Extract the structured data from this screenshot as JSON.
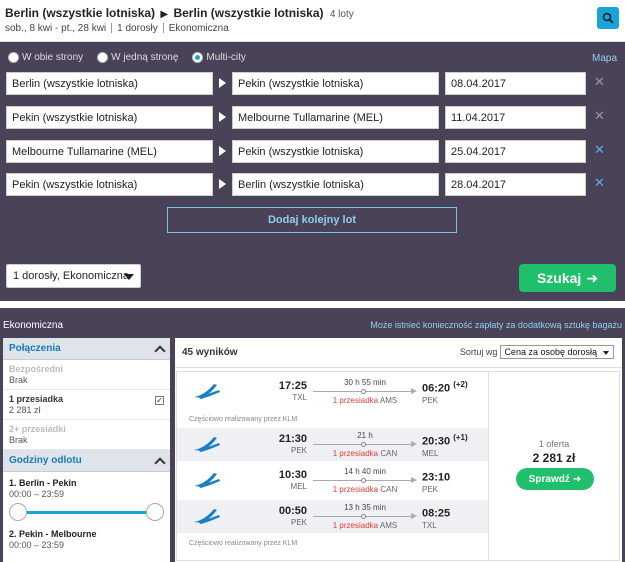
{
  "summary": {
    "origin": "Berlin (wszystkie lotniska)",
    "destination": "Berlin (wszystkie lotniska)",
    "legs_count": "4 loty",
    "dates": "sob., 8 kwi - pt., 28 kwi",
    "passengers": "1 dorosły",
    "cabin": "Ekonomiczna"
  },
  "search": {
    "trip_types": [
      {
        "label": "W obie strony",
        "selected": false
      },
      {
        "label": "W jedną stronę",
        "selected": false
      },
      {
        "label": "Multi-city",
        "selected": true
      }
    ],
    "map_link": "Mapa",
    "legs": [
      {
        "from": "Berlin (wszystkie lotniska)",
        "to": "Pekin (wszystkie lotniska)",
        "date": "08.04.2017",
        "remove_icon": "close-icon-grey"
      },
      {
        "from": "Pekin (wszystkie lotniska)",
        "to": "Melbourne Tullamarine (MEL)",
        "date": "11.04.2017",
        "remove_icon": "close-icon-grey"
      },
      {
        "from": "Melbourne Tullamarine (MEL)",
        "to": "Pekin (wszystkie lotniska)",
        "date": "25.04.2017",
        "remove_icon": "close-icon-blue"
      },
      {
        "from": "Pekin (wszystkie lotniska)",
        "to": "Berlin (wszystkie lotniska)",
        "date": "28.04.2017",
        "remove_icon": "close-icon-blue"
      }
    ],
    "add_flight": "Dodaj kolejny lot",
    "pax_selector": "1 dorosły, Ekonomiczna",
    "search_button": "Szukaj"
  },
  "results": {
    "cabin_label": "Ekonomiczna",
    "baggage_note": "Może istnieć konieczność zapłaty za dodatkową sztukę bagażu",
    "count": "45 wyników",
    "sort_label": "Sortuj wg",
    "sort_value": "Cena za osobę dorosłą",
    "filters": {
      "connections_title": "Połączenia",
      "connections": [
        {
          "label": "Bezpośredni",
          "value": "Brak",
          "dim": true,
          "checked": false
        },
        {
          "label": "1 przesiadka",
          "value": "2 281 zł",
          "dim": false,
          "checked": true
        },
        {
          "label": "2+ przesiadki",
          "value": "Brak",
          "dim": true,
          "checked": false
        }
      ],
      "times_title": "Godziny odlotu",
      "times": [
        {
          "label": "1. Berlin - Pekin",
          "range": "00:00 – 23:59"
        },
        {
          "label": "2. Pekin - Melbourne",
          "range": "00:00 – 23:59"
        }
      ]
    },
    "itinerary": {
      "legs": [
        {
          "dep_time": "17:25",
          "dep_ap": "TXL",
          "duration": "30 h 55 min",
          "stops": "1 przesiadka",
          "stop_code": "AMS",
          "arr_time": "06:20",
          "arr_plus": "(+2)",
          "arr_ap": "PEK"
        },
        {
          "dep_time": "21:30",
          "dep_ap": "PEK",
          "duration": "21 h",
          "stops": "1 przesiadka",
          "stop_code": "CAN",
          "arr_time": "20:30",
          "arr_plus": "(+1)",
          "arr_ap": "MEL"
        },
        {
          "dep_time": "10:30",
          "dep_ap": "MEL",
          "duration": "14 h 40 min",
          "stops": "1 przesiadka",
          "stop_code": "CAN",
          "arr_time": "23:10",
          "arr_plus": "",
          "arr_ap": "PEK"
        },
        {
          "dep_time": "00:50",
          "dep_ap": "PEK",
          "duration": "13 h 35 min",
          "stops": "1 przesiadka",
          "stop_code": "AMS",
          "arr_time": "08:25",
          "arr_plus": "",
          "arr_ap": "TXL"
        }
      ],
      "partial_note_1": "Częściowo realizowany przez KLM",
      "partial_note_2": "Częściowo realizowany przez KLM",
      "offers_count": "1 oferta",
      "price": "2 281 zł",
      "check_button": "Sprawdź"
    }
  },
  "colors": {
    "panel_bg": "#4a4257",
    "accent_blue": "#1aa3d9",
    "green": "#1fbf6b",
    "stop_red": "#e0403a"
  }
}
